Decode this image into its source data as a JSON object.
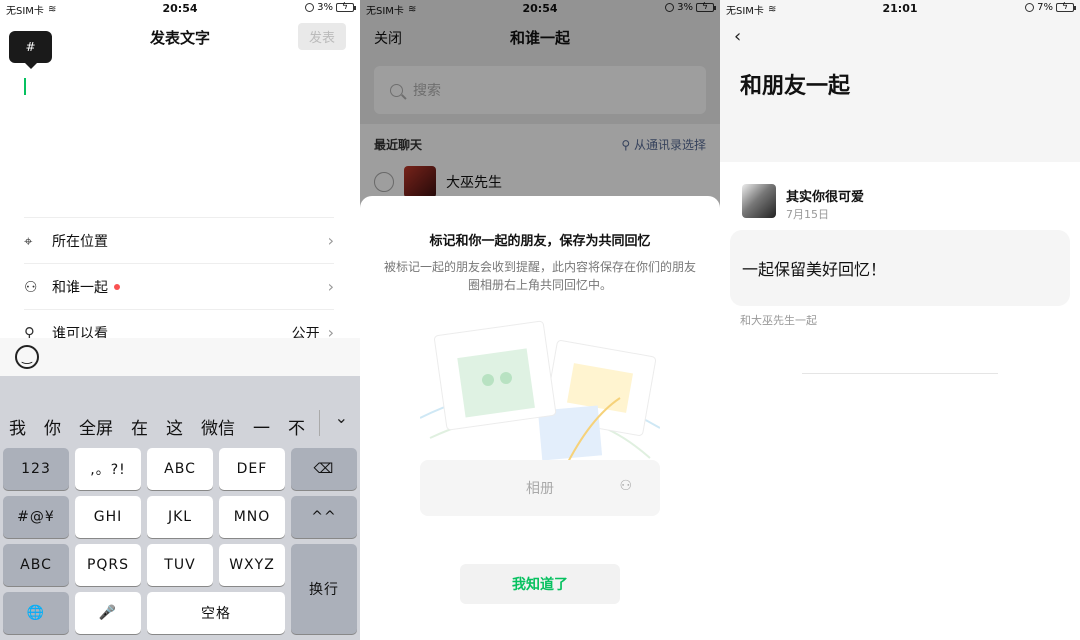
{
  "panel1": {
    "status": {
      "carrier": "无SIM卡",
      "time": "20:54",
      "battery": "3%"
    },
    "title": "发表文字",
    "publish_label": "发表",
    "hash_tip": "#",
    "options": [
      {
        "icon": "location-pin-icon",
        "label": "所在位置",
        "value": "",
        "dot": false
      },
      {
        "icon": "people-icon",
        "label": "和谁一起",
        "value": "",
        "dot": true
      },
      {
        "icon": "person-icon",
        "label": "谁可以看",
        "value": "公开",
        "dot": false
      }
    ],
    "keyboard": {
      "candidates": [
        "我",
        "你",
        "全屏",
        "在",
        "这",
        "微信",
        "一",
        "不"
      ],
      "rows": [
        [
          "123",
          ",。?!",
          "ABC",
          "DEF",
          "⌫"
        ],
        [
          "#@¥",
          "GHI",
          "JKL",
          "MNO",
          "^^"
        ],
        [
          "ABC",
          "PQRS",
          "TUV",
          "WXYZ",
          "换行"
        ],
        [
          "🌐",
          "🎤",
          "空格"
        ]
      ]
    }
  },
  "panel2": {
    "status": {
      "carrier": "无SIM卡",
      "time": "20:54",
      "battery": "3%"
    },
    "close_label": "关闭",
    "title": "和谁一起",
    "search_placeholder": "搜索",
    "recent_label": "最近聊天",
    "contacts_link": "从通讯录选择",
    "contact_name": "大巫先生",
    "sheet": {
      "title": "标记和你一起的朋友，保存为共同回忆",
      "desc": "被标记一起的朋友会收到提醒，此内容将保存在你们的朋友圈相册右上角共同回忆中。",
      "album_label": "相册",
      "ok_label": "我知道了"
    }
  },
  "panel3": {
    "status": {
      "carrier": "无SIM卡",
      "time": "21:01",
      "battery": "7%"
    },
    "title": "和朋友一起",
    "post_author": "其实你很可爱",
    "post_date": "7月15日",
    "post_text": "一起保留美好回忆！",
    "with_text": "和大巫先生一起"
  },
  "colors": {
    "accent": "#07c160",
    "link": "#576b95",
    "red_dot": "#fa5151"
  }
}
